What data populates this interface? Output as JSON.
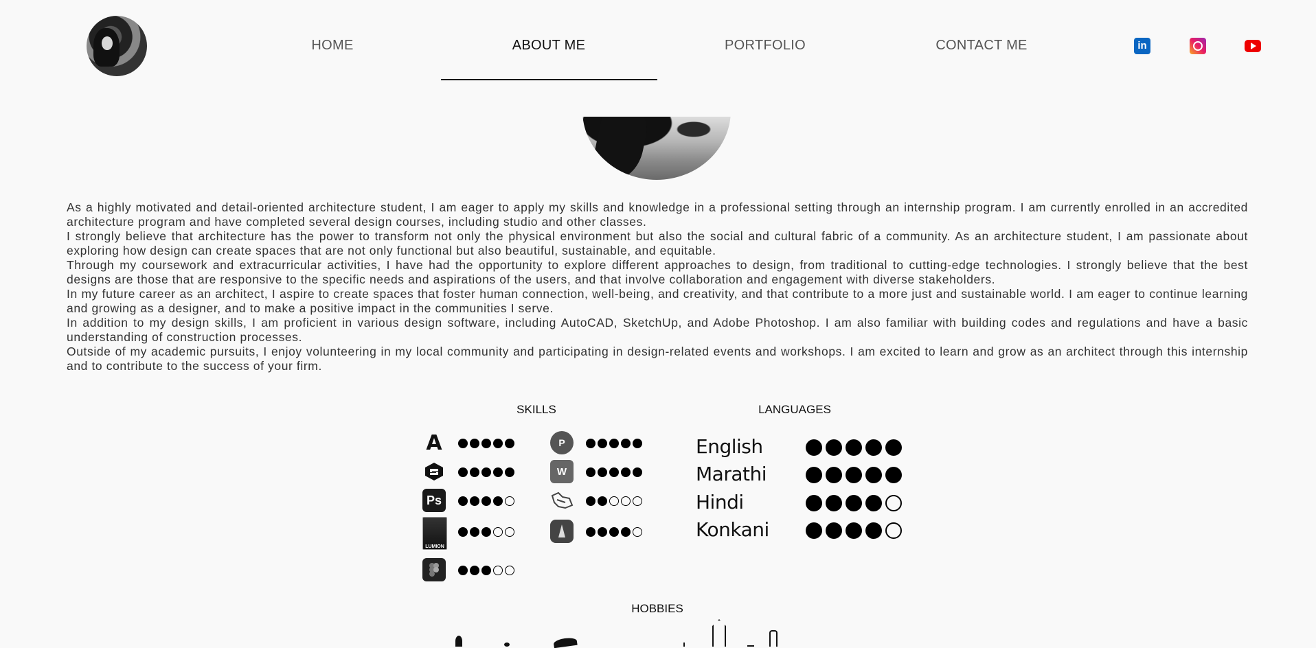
{
  "nav": {
    "items": [
      {
        "label": "HOME",
        "active": false
      },
      {
        "label": "ABOUT ME",
        "active": true
      },
      {
        "label": "PORTFOLIO",
        "active": false
      },
      {
        "label": "CONTACT ME",
        "active": false
      }
    ],
    "social": [
      "linkedin-icon",
      "instagram-icon",
      "youtube-icon"
    ]
  },
  "bio": [
    "As a highly motivated and detail-oriented architecture student, I am eager to apply my skills and knowledge in a professional setting through an internship program. I am currently enrolled in an accredited architecture program and have completed several design courses, including studio and other classes.",
    "I strongly believe that architecture has the power to transform not only the physical environment but also the social and cultural fabric of a community. As an architecture student, I am passionate about exploring how design can create spaces that are not only functional but also beautiful, sustainable, and equitable.",
    "Through my coursework and extracurricular activities, I have had the opportunity to explore different approaches to design, from traditional to cutting-edge technologies. I strongly believe that the best designs are those that are responsive to the specific needs and aspirations of the users, and that involve collaboration and engagement with diverse stakeholders.",
    "In my future career as an architect, I aspire to create spaces that foster human connection, well-being, and creativity, and that contribute to a more just and sustainable world. I am eager to continue learning and growing as a designer, and to make a positive impact in the communities I serve.",
    "In addition to my design skills, I am proficient in various design software, including AutoCAD, SketchUp, and Adobe Photoshop. I am also familiar with building codes and regulations and have a basic understanding of construction processes.",
    "Outside of my academic pursuits, I enjoy volunteering in my local community and participating in design-related events and workshops. I am excited to learn and grow as an architect through this internship and to contribute to the success of your firm."
  ],
  "sections": {
    "skills": "SKILLS",
    "languages": "LANGUAGES",
    "hobbies": "HOBBIES"
  },
  "skills": [
    {
      "icon": "autocad-icon",
      "glyph": "A",
      "rating": 5
    },
    {
      "icon": "sketchup-icon",
      "glyph": "",
      "rating": 5
    },
    {
      "icon": "photoshop-icon",
      "glyph": "Ps",
      "rating": 4
    },
    {
      "icon": "lumion-icon",
      "glyph": "LUMION",
      "rating": 3
    },
    {
      "icon": "figma-icon",
      "glyph": "",
      "rating": 3
    },
    {
      "icon": "powerpoint-icon",
      "glyph": "P",
      "rating": 5
    },
    {
      "icon": "word-icon",
      "glyph": "W",
      "rating": 5
    },
    {
      "icon": "rhino-icon",
      "glyph": "",
      "rating": 2
    },
    {
      "icon": "vectorworks-icon",
      "glyph": "",
      "rating": 4
    }
  ],
  "languages": [
    {
      "name": "English",
      "rating": 5
    },
    {
      "name": "Marathi",
      "rating": 5
    },
    {
      "name": "Hindi",
      "rating": 4
    },
    {
      "name": "Konkani",
      "rating": 4
    }
  ]
}
